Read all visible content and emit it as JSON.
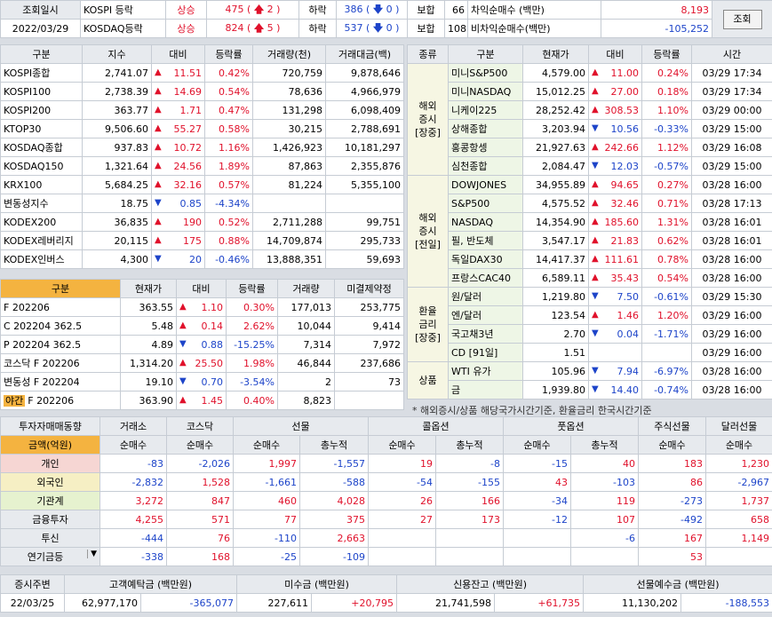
{
  "top": {
    "label1": "조회일시",
    "date": "2022/03/29",
    "rows": [
      {
        "market": "KOSPI 등락",
        "state": "상승",
        "up": "475",
        "up_arrow": "2",
        "down_label": "하락",
        "down": "386",
        "down_arrow": "0",
        "flat_label": "보합",
        "flat": "66"
      },
      {
        "market": "KOSDAQ등락",
        "state": "상승",
        "up": "824",
        "up_arrow": "5",
        "down_label": "하락",
        "down": "537",
        "down_arrow": "0",
        "flat_label": "보합",
        "flat": "108"
      }
    ],
    "arb": [
      {
        "label": "차익순매수  (백만)",
        "value": "8,193"
      },
      {
        "label": "비차익순매수(백만)",
        "value": "-105,252"
      }
    ],
    "query_button": "조회"
  },
  "index_table": {
    "headers": [
      "구분",
      "지수",
      "대비",
      "등락률",
      "거래량(천)",
      "거래대금(백)"
    ],
    "rows": [
      {
        "name": "KOSPI종합",
        "value": "2,741.07",
        "dir": "up",
        "chg": "11.51",
        "rate": "0.42%",
        "vol": "720,759",
        "amt": "9,878,646"
      },
      {
        "name": "KOSPI100",
        "value": "2,738.39",
        "dir": "up",
        "chg": "14.69",
        "rate": "0.54%",
        "vol": "78,636",
        "amt": "4,966,979"
      },
      {
        "name": "KOSPI200",
        "value": "363.77",
        "dir": "up",
        "chg": "1.71",
        "rate": "0.47%",
        "vol": "131,298",
        "amt": "6,098,409"
      },
      {
        "name": "KTOP30",
        "value": "9,506.60",
        "dir": "up",
        "chg": "55.27",
        "rate": "0.58%",
        "vol": "30,215",
        "amt": "2,788,691"
      },
      {
        "name": "KOSDAQ종합",
        "value": "937.83",
        "dir": "up",
        "chg": "10.72",
        "rate": "1.16%",
        "vol": "1,426,923",
        "amt": "10,181,297"
      },
      {
        "name": "KOSDAQ150",
        "value": "1,321.64",
        "dir": "up",
        "chg": "24.56",
        "rate": "1.89%",
        "vol": "87,863",
        "amt": "2,355,876"
      },
      {
        "name": "KRX100",
        "value": "5,684.25",
        "dir": "up",
        "chg": "32.16",
        "rate": "0.57%",
        "vol": "81,224",
        "amt": "5,355,100"
      },
      {
        "name": "변동성지수",
        "value": "18.75",
        "dir": "dn",
        "chg": "0.85",
        "rate": "-4.34%",
        "vol": "",
        "amt": ""
      },
      {
        "name": "KODEX200",
        "value": "36,835",
        "dir": "up",
        "chg": "190",
        "rate": "0.52%",
        "vol": "2,711,288",
        "amt": "99,751"
      },
      {
        "name": "KODEX레버리지",
        "value": "20,115",
        "dir": "up",
        "chg": "175",
        "rate": "0.88%",
        "vol": "14,709,874",
        "amt": "295,733"
      },
      {
        "name": "KODEX인버스",
        "value": "4,300",
        "dir": "dn",
        "chg": "20",
        "rate": "-0.46%",
        "vol": "13,888,351",
        "amt": "59,693"
      }
    ]
  },
  "futures_table": {
    "headers": [
      "구분",
      "현재가",
      "대비",
      "등락률",
      "거래량",
      "미결제약정"
    ],
    "rows": [
      {
        "name": "F 202206",
        "price": "363.55",
        "dir": "up",
        "chg": "1.10",
        "rate": "0.30%",
        "vol": "177,013",
        "oi": "253,775"
      },
      {
        "name": "C 202204 362.5",
        "price": "5.48",
        "dir": "up",
        "chg": "0.14",
        "rate": "2.62%",
        "vol": "10,044",
        "oi": "9,414"
      },
      {
        "name": "P 202204 362.5",
        "price": "4.89",
        "dir": "dn",
        "chg": "0.88",
        "rate": "-15.25%",
        "vol": "7,314",
        "oi": "7,972"
      },
      {
        "name": "코스닥 F 202206",
        "price": "1,314.20",
        "dir": "up",
        "chg": "25.50",
        "rate": "1.98%",
        "vol": "46,844",
        "oi": "237,686"
      },
      {
        "name": "변동성 F 202204",
        "price": "19.10",
        "dir": "dn",
        "chg": "0.70",
        "rate": "-3.54%",
        "vol": "2",
        "oi": "73"
      },
      {
        "name": "F 202206",
        "tag": "야간",
        "price": "363.90",
        "dir": "up",
        "chg": "1.45",
        "rate": "0.40%",
        "vol": "8,823",
        "oi": ""
      }
    ]
  },
  "world_table": {
    "headers": [
      "종류",
      "구분",
      "현재가",
      "대비",
      "등락률",
      "시간"
    ],
    "groups": [
      {
        "label": "해외\n증시\n[장중]",
        "rows": [
          {
            "name": "미니S&P500",
            "price": "4,579.00",
            "dir": "up",
            "chg": "11.00",
            "rate": "0.24%",
            "time": "03/29 17:34"
          },
          {
            "name": "미니NASDAQ",
            "price": "15,012.25",
            "dir": "up",
            "chg": "27.00",
            "rate": "0.18%",
            "time": "03/29 17:34"
          },
          {
            "name": "니케이225",
            "price": "28,252.42",
            "dir": "up",
            "chg": "308.53",
            "rate": "1.10%",
            "time": "03/29 00:00"
          },
          {
            "name": "상해종합",
            "price": "3,203.94",
            "dir": "dn",
            "chg": "10.56",
            "rate": "-0.33%",
            "time": "03/29 15:00"
          },
          {
            "name": "홍콩항셍",
            "price": "21,927.63",
            "dir": "up",
            "chg": "242.66",
            "rate": "1.12%",
            "time": "03/29 16:08"
          },
          {
            "name": "심천종합",
            "price": "2,084.47",
            "dir": "dn",
            "chg": "12.03",
            "rate": "-0.57%",
            "time": "03/29 15:00"
          }
        ]
      },
      {
        "label": "해외\n증시\n[전일]",
        "rows": [
          {
            "name": "DOWJONES",
            "price": "34,955.89",
            "dir": "up",
            "chg": "94.65",
            "rate": "0.27%",
            "time": "03/28 16:00"
          },
          {
            "name": "S&P500",
            "price": "4,575.52",
            "dir": "up",
            "chg": "32.46",
            "rate": "0.71%",
            "time": "03/28 17:13"
          },
          {
            "name": "NASDAQ",
            "price": "14,354.90",
            "dir": "up",
            "chg": "185.60",
            "rate": "1.31%",
            "time": "03/28 16:01"
          },
          {
            "name": "필, 반도체",
            "price": "3,547.17",
            "dir": "up",
            "chg": "21.83",
            "rate": "0.62%",
            "time": "03/28 16:01"
          },
          {
            "name": "독일DAX30",
            "price": "14,417.37",
            "dir": "up",
            "chg": "111.61",
            "rate": "0.78%",
            "time": "03/28 16:00"
          },
          {
            "name": "프랑스CAC40",
            "price": "6,589.11",
            "dir": "up",
            "chg": "35.43",
            "rate": "0.54%",
            "time": "03/28 16:00"
          }
        ]
      },
      {
        "label": "환율\n금리\n[장중]",
        "rows": [
          {
            "name": "원/달러",
            "price": "1,219.80",
            "dir": "dn",
            "chg": "7.50",
            "rate": "-0.61%",
            "time": "03/29 15:30"
          },
          {
            "name": "엔/달러",
            "price": "123.54",
            "dir": "up",
            "chg": "1.46",
            "rate": "1.20%",
            "time": "03/29 16:00"
          },
          {
            "name": "국고채3년",
            "price": "2.70",
            "dir": "dn",
            "chg": "0.04",
            "rate": "-1.71%",
            "time": "03/29 16:00"
          },
          {
            "name": "CD [91일]",
            "price": "1.51",
            "dir": "",
            "chg": "",
            "rate": "",
            "time": "03/29 16:00"
          }
        ]
      },
      {
        "label": "상품",
        "rows": [
          {
            "name": "WTI 유가",
            "price": "105.96",
            "dir": "dn",
            "chg": "7.94",
            "rate": "-6.97%",
            "time": "03/28 16:00"
          },
          {
            "name": "금",
            "price": "1,939.80",
            "dir": "dn",
            "chg": "14.40",
            "rate": "-0.74%",
            "time": "03/28 16:00"
          }
        ]
      }
    ],
    "note": "* 해외증시/상품 해당국가시간기준, 환율금리 한국시간기준"
  },
  "investor": {
    "title": "투자자매매동향",
    "unit": "금액(억원)",
    "col_groups": [
      "거래소",
      "코스닥",
      "선물",
      "콜옵션",
      "풋옵션",
      "주식선물",
      "달러선물"
    ],
    "sub": [
      "순매수",
      "순매수",
      "순매수",
      "총누적",
      "순매수",
      "총누적",
      "순매수",
      "총누적",
      "순매수",
      "순매수"
    ],
    "rows": [
      {
        "name": "개인",
        "cls": "pink",
        "v": [
          "-83",
          "-2,026",
          "1,997",
          "-1,557",
          "19",
          "-8",
          "-15",
          "40",
          "183",
          "1,230"
        ]
      },
      {
        "name": "외국인",
        "cls": "yel",
        "v": [
          "-2,832",
          "1,528",
          "-1,661",
          "-588",
          "-54",
          "-155",
          "43",
          "-103",
          "86",
          "-2,967"
        ]
      },
      {
        "name": "기관계",
        "cls": "grn",
        "v": [
          "3,272",
          "847",
          "460",
          "4,028",
          "26",
          "166",
          "-34",
          "119",
          "-273",
          "1,737"
        ]
      },
      {
        "name": "금융투자",
        "cls": "",
        "v": [
          "4,255",
          "571",
          "77",
          "375",
          "27",
          "173",
          "-12",
          "107",
          "-492",
          "658"
        ]
      },
      {
        "name": "투신",
        "cls": "",
        "v": [
          "-444",
          "76",
          "-110",
          "2,663",
          "",
          "",
          "",
          "-6",
          "167",
          "1,149"
        ]
      },
      {
        "name": "연기금등",
        "cls": "",
        "v": [
          "-338",
          "168",
          "-25",
          "-109",
          "",
          "",
          "",
          "",
          "53",
          ""
        ]
      }
    ]
  },
  "bottom": {
    "headers": [
      "증시주변",
      "고객예탁금 (백만원)",
      "미수금 (백만원)",
      "신용잔고 (백만원)",
      "선물예수금 (백만원)"
    ],
    "date": "22/03/25",
    "values": [
      {
        "v": "62,977,170",
        "c": "-365,077"
      },
      {
        "v": "227,611",
        "c": "+20,795"
      },
      {
        "v": "21,741,598",
        "c": "+61,735"
      },
      {
        "v": "11,130,202",
        "c": "-188,553"
      }
    ]
  }
}
